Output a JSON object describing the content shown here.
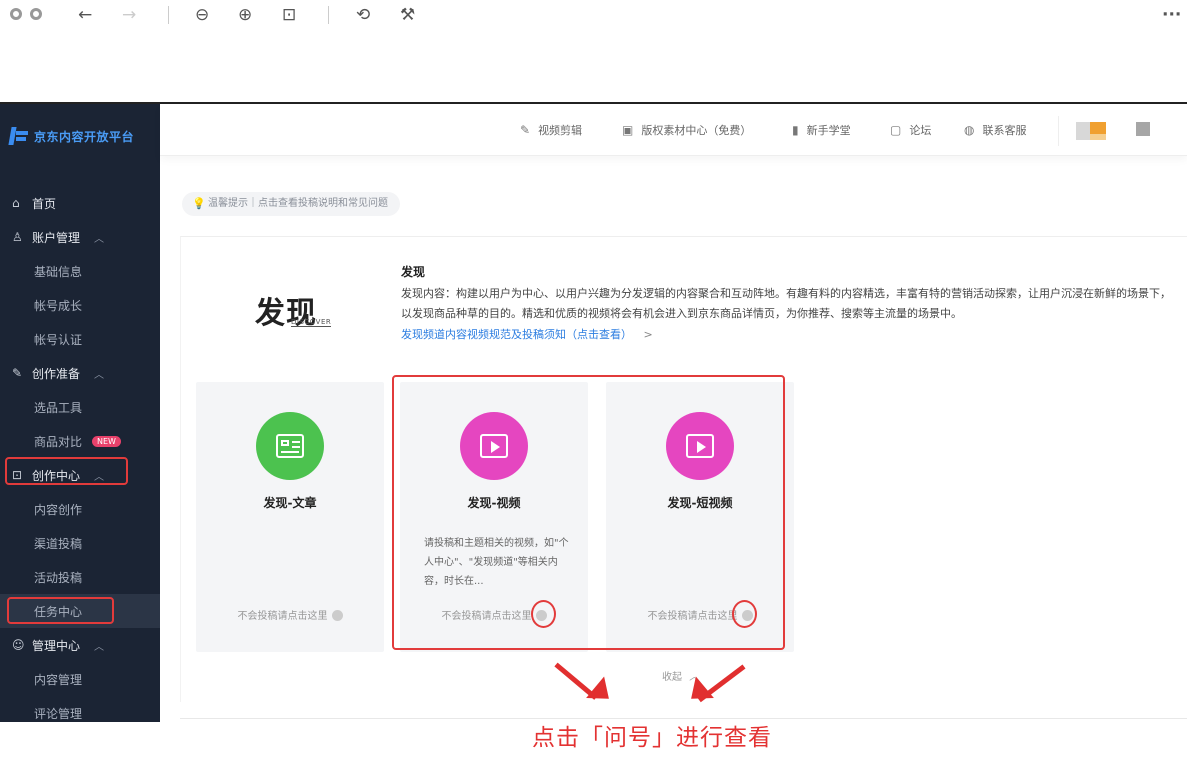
{
  "viewer_toolbar": {
    "back": "←",
    "forward": "→",
    "zoom_out": "⊖",
    "zoom_in": "⊕",
    "fit": "⊡",
    "rotate": "⟲",
    "tools": "⚒",
    "more": "···"
  },
  "sidebar": {
    "logo_text": "京东内容开放平台",
    "items": [
      {
        "label": "首页",
        "kind": "group",
        "icon": "home-icon",
        "glyph": "⌂"
      },
      {
        "label": "账户管理",
        "kind": "group",
        "icon": "user-icon",
        "glyph": "♙",
        "chevron": "︿"
      },
      {
        "label": "基础信息",
        "kind": "sub"
      },
      {
        "label": "帐号成长",
        "kind": "sub"
      },
      {
        "label": "帐号认证",
        "kind": "sub"
      },
      {
        "label": "创作准备",
        "kind": "group",
        "icon": "pen-icon",
        "glyph": "✎",
        "chevron": "︿"
      },
      {
        "label": "选品工具",
        "kind": "sub"
      },
      {
        "label": "商品对比",
        "kind": "sub",
        "badge": "NEW"
      },
      {
        "label": "创作中心",
        "kind": "group",
        "icon": "create-icon",
        "glyph": "⊡",
        "chevron": "︿"
      },
      {
        "label": "内容创作",
        "kind": "sub"
      },
      {
        "label": "渠道投稿",
        "kind": "sub"
      },
      {
        "label": "活动投稿",
        "kind": "sub"
      },
      {
        "label": "任务中心",
        "kind": "sub",
        "active": true
      },
      {
        "label": "管理中心",
        "kind": "group",
        "icon": "manage-icon",
        "glyph": "☺",
        "chevron": "︿"
      },
      {
        "label": "内容管理",
        "kind": "sub"
      },
      {
        "label": "评论管理",
        "kind": "sub"
      }
    ]
  },
  "header": {
    "links": [
      {
        "label": "视频剪辑",
        "icon": "edit-icon",
        "glyph": "✎"
      },
      {
        "label": "版权素材中心（免费）",
        "icon": "image-icon",
        "glyph": "▣"
      },
      {
        "label": "新手学堂",
        "icon": "book-icon",
        "glyph": "▮"
      },
      {
        "label": "论坛",
        "icon": "forum-icon",
        "glyph": "▢"
      },
      {
        "label": "联系客服",
        "icon": "service-icon",
        "glyph": "◍"
      }
    ]
  },
  "tip": {
    "text": "温馨提示｜点击查看投稿说明和常见问题"
  },
  "intro": {
    "logo_big": "发现",
    "logo_small": "DISCOVER",
    "title": "发现",
    "text": "发现内容：构建以用户为中心、以用户兴趣为分发逻辑的内容聚合和互动阵地。有趣有料的内容精选，丰富有特的营销活动探索，让用户沉浸在新鲜的场景下，以发现商品种草的目的。精选和优质的视频将会有机会进入到京东商品详情页，为你推荐、搜索等主流量的场景中。",
    "link": "发现频道内容视频规范及投稿须知（点击查看）",
    "link_arrow": ">"
  },
  "cards": [
    {
      "title": "发现-文章",
      "desc": "",
      "footer": "不会投稿请点击这里",
      "color": "#4cc24f",
      "icon": "article-icon"
    },
    {
      "title": "发现-视频",
      "desc": "请投稿和主题相关的视频，如\"个人中心\"、\"发现频道\"等相关内容，时长在...",
      "footer": "不会投稿请点击这里",
      "color": "#e546c0",
      "icon": "video-icon"
    },
    {
      "title": "发现-短视频",
      "desc": "",
      "footer": "不会投稿请点击这里",
      "color": "#e546c0",
      "icon": "video-icon"
    }
  ],
  "collapse": {
    "label": "收起",
    "chevron": "︿"
  },
  "caption": "点击「问号」进行查看",
  "colors": {
    "accent_red": "#e23b3b",
    "sidebar_bg": "#1b2434",
    "link_blue": "#2c7de0"
  }
}
